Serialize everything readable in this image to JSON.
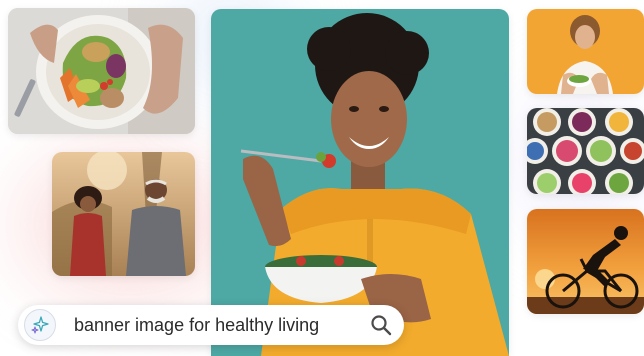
{
  "search": {
    "query": "banner image for healthy living",
    "ai_icon": "sparkles-icon",
    "search_icon": "search-icon"
  },
  "images": [
    {
      "name": "image-salad-bowl",
      "description_icon": "photo-icon"
    },
    {
      "name": "image-couple-jogging",
      "description_icon": "photo-icon"
    },
    {
      "name": "image-woman-eating-salad",
      "description_icon": "photo-icon"
    },
    {
      "name": "image-woman-orange-background",
      "description_icon": "photo-icon"
    },
    {
      "name": "image-smoothie-bowls",
      "description_icon": "photo-icon"
    },
    {
      "name": "image-cyclist-sunset",
      "description_icon": "photo-icon"
    }
  ],
  "colors": {
    "teal_background": "#4ea8a4",
    "orange_background": "#f3a533",
    "sunset": "#f0952a",
    "accent_glow_pink": "#f4c6cf",
    "accent_glow_blue": "#d8e6f6"
  }
}
